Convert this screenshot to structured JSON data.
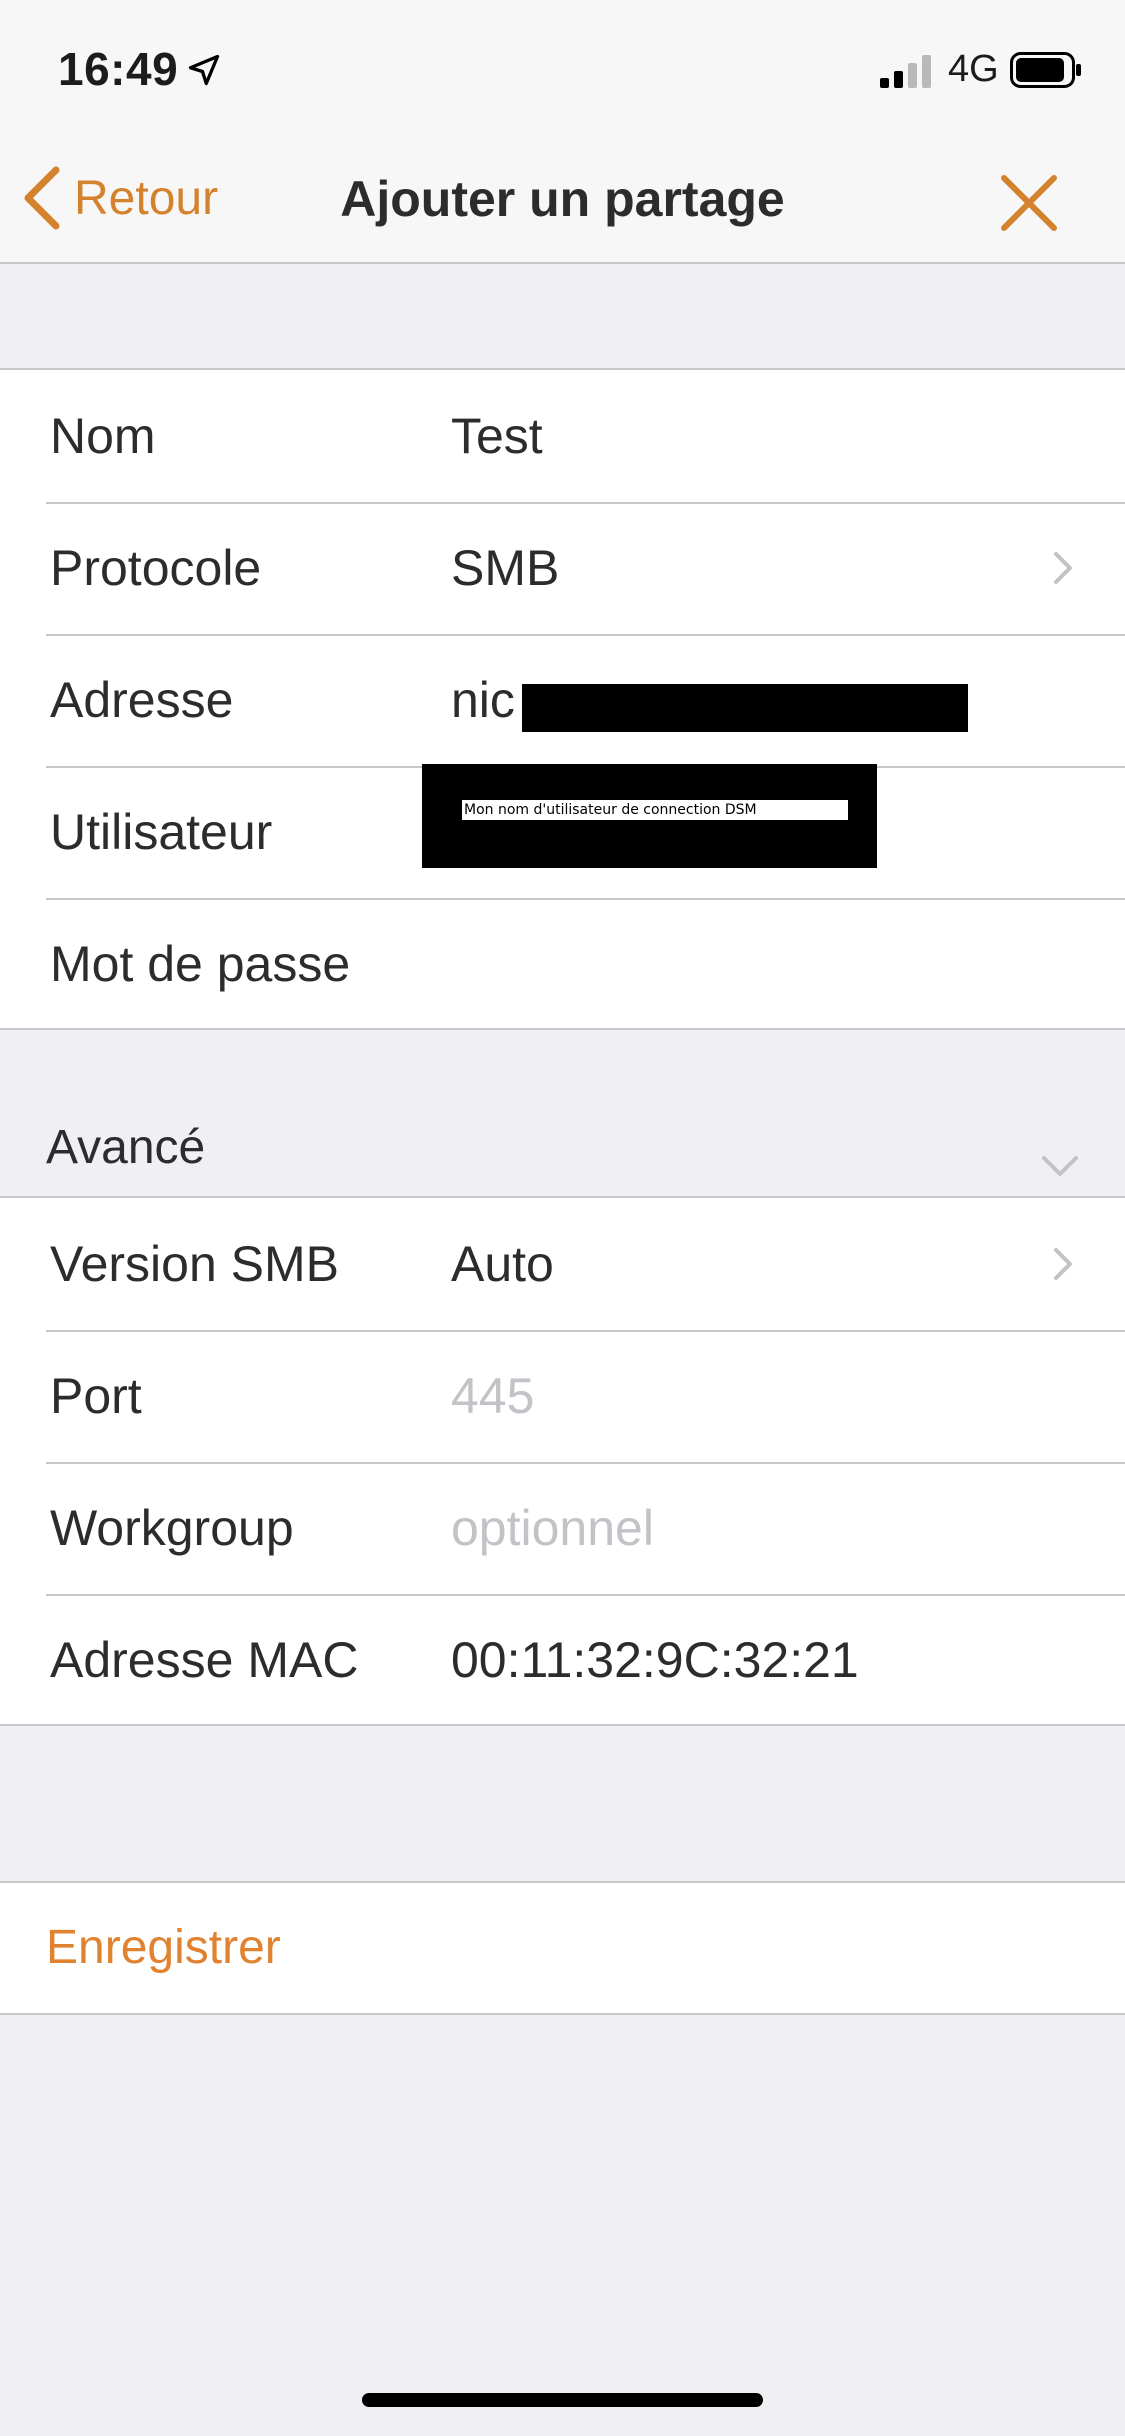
{
  "status_bar": {
    "time": "16:49",
    "network": "4G",
    "icons": [
      "location-arrow-icon",
      "signal-icon",
      "battery-icon"
    ]
  },
  "nav": {
    "back_label": "Retour",
    "title": "Ajouter un partage",
    "icons": [
      "chevron-left-icon",
      "close-icon"
    ]
  },
  "main_form": {
    "rows": [
      {
        "label": "Nom",
        "value": "Test"
      },
      {
        "label": "Protocole",
        "value": "SMB"
      },
      {
        "label": "Adresse",
        "value": "nic"
      },
      {
        "label": "Utilisateur",
        "value": "Mon nom d'utilisateur de connection DSM"
      },
      {
        "label": "Mot de passe",
        "value": ""
      }
    ]
  },
  "advanced": {
    "header": "Avancé",
    "rows": [
      {
        "label": "Version SMB",
        "value": "Auto"
      },
      {
        "label": "Port",
        "placeholder": "445"
      },
      {
        "label": "Workgroup",
        "placeholder": "optionnel"
      },
      {
        "label": "Adresse MAC",
        "value": "00:11:32:9C:32:21"
      }
    ]
  },
  "save_label": "Enregistrer",
  "colors": {
    "accent": "#d4822d",
    "background": "#efeff4",
    "cell": "#ffffff",
    "separator": "#c8c7cc",
    "placeholder": "#c2c2c7"
  }
}
